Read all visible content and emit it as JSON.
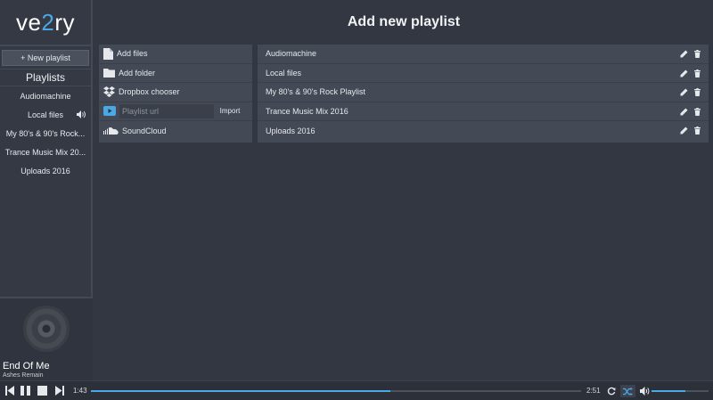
{
  "app": {
    "logo_pre": "ve",
    "logo_accent": "2",
    "logo_post": "ry",
    "accent_color": "#4aa8e6"
  },
  "sidebar": {
    "new_playlist_label": "+ New playlist",
    "heading": "Playlists",
    "items": [
      {
        "label": "Audiomachine"
      },
      {
        "label": "Local files",
        "playing": true
      },
      {
        "label": "My 80's & 90's Rock..."
      },
      {
        "label": "Trance Music Mix 20..."
      },
      {
        "label": "Uploads 2016"
      }
    ]
  },
  "main": {
    "title": "Add new playlist",
    "sources": {
      "add_files": "Add files",
      "add_folder": "Add folder",
      "dropbox": "Dropbox chooser",
      "url_placeholder": "Playlist url",
      "import_label": "Import",
      "soundcloud": "SoundCloud"
    },
    "playlists": [
      {
        "name": "Audiomachine"
      },
      {
        "name": "Local files"
      },
      {
        "name": "My 80's & 90's Rock Playlist"
      },
      {
        "name": "Trance Music Mix 2016"
      },
      {
        "name": "Uploads 2016"
      }
    ]
  },
  "now_playing": {
    "title": "End Of Me",
    "artist": "Ashes Remain"
  },
  "player": {
    "elapsed": "1:43",
    "duration": "2:51",
    "progress_fraction": 0.61,
    "volume_fraction": 0.6,
    "icons": [
      "skip-back-icon",
      "pause-icon",
      "stop-icon",
      "skip-forward-icon",
      "repeat-icon",
      "shuffle-icon",
      "volume-icon"
    ]
  }
}
